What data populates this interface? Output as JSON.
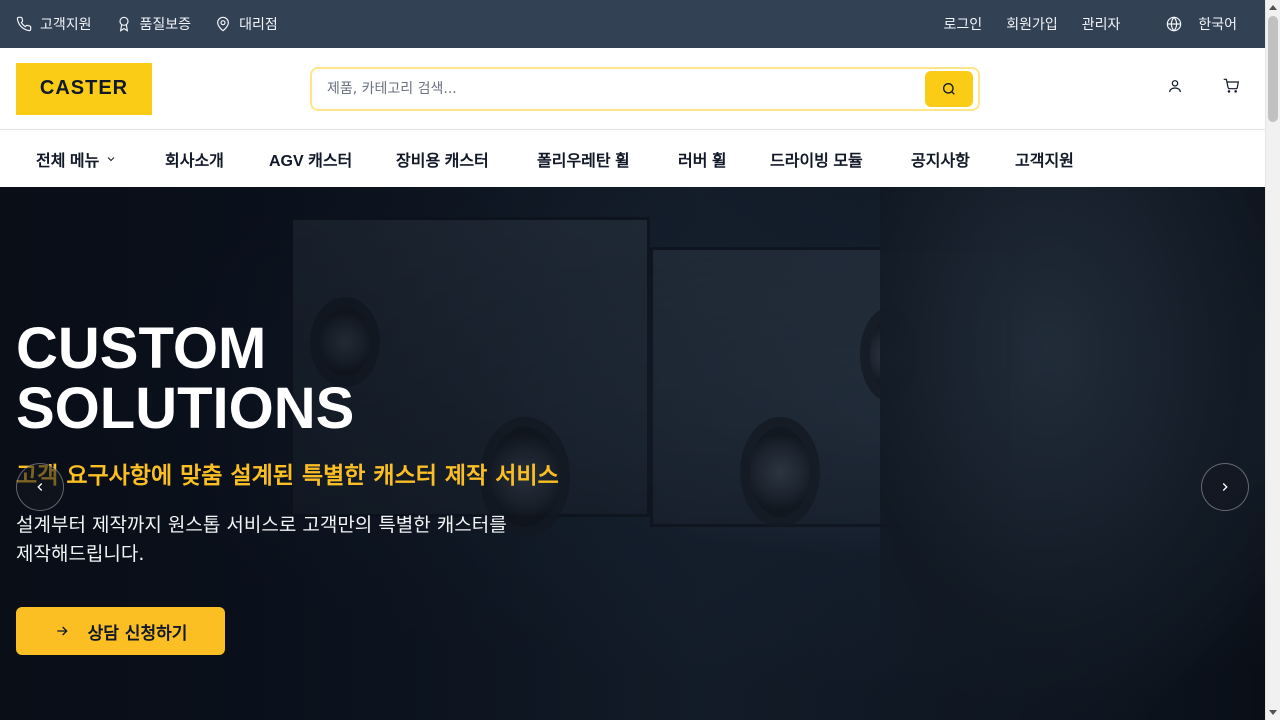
{
  "topbar": {
    "left_items": [
      {
        "label": "고객지원",
        "icon": "phone-icon"
      },
      {
        "label": "품질보증",
        "icon": "award-icon"
      },
      {
        "label": "대리점",
        "icon": "map-pin-icon"
      }
    ],
    "right_items": [
      "로그인",
      "회원가입",
      "관리자"
    ],
    "language": {
      "label": "한국어",
      "icon": "globe-icon"
    }
  },
  "header": {
    "logo": "CASTER",
    "search_placeholder": "제품, 카테고리 검색...",
    "icons": [
      "user-icon",
      "cart-icon"
    ]
  },
  "nav": {
    "items": [
      "전체 메뉴",
      "회사소개",
      "AGV 캐스터",
      "장비용 캐스터",
      "폴리우레탄 휠",
      "러버 휠",
      "드라이빙 모듈",
      "공지사항",
      "고객지원"
    ]
  },
  "hero": {
    "title_line1": "CUSTOM",
    "title_line2": "SOLUTIONS",
    "subtitle": "고객 요구사항에 맞춤 설계된 특별한 캐스터 제작 서비스",
    "description": "설계부터 제작까지 원스톱 서비스로 고객만의 특별한 캐스터를 제작해드립니다.",
    "cta_label": "상담 신청하기"
  },
  "colors": {
    "topbar": "#334155",
    "accent": "#facc15",
    "subtitle": "#fbbf24"
  }
}
